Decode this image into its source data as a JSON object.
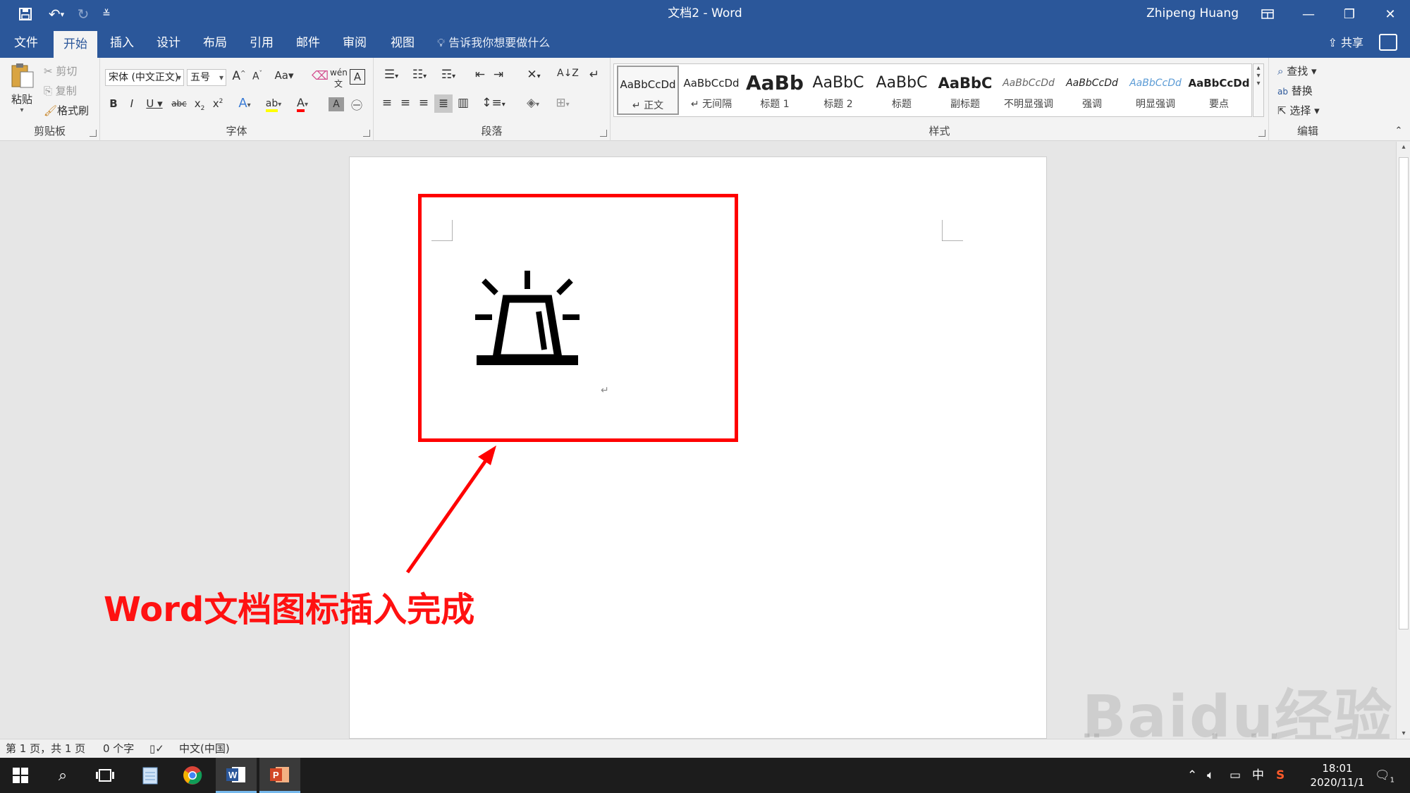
{
  "window": {
    "title": "文档2  -  Word",
    "user": "Zhipeng Huang"
  },
  "tabs": [
    "文件",
    "开始",
    "插入",
    "设计",
    "布局",
    "引用",
    "邮件",
    "审阅",
    "视图"
  ],
  "tell_me": "告诉我你想要做什么",
  "share": "共享",
  "clipboard": {
    "paste": "粘贴",
    "cut": "剪切",
    "copy": "复制",
    "format_painter": "格式刷",
    "label": "剪贴板"
  },
  "font": {
    "font_name": "宋体 (中文正文)",
    "font_size": "五号",
    "label": "字体"
  },
  "paragraph": {
    "label": "段落"
  },
  "styles": {
    "label": "样式",
    "items": [
      {
        "sample": "AaBbCcDd",
        "name": "↵ 正文"
      },
      {
        "sample": "AaBbCcDd",
        "name": "↵ 无间隔"
      },
      {
        "sample": "AaBb",
        "name": "标题 1"
      },
      {
        "sample": "AaBbC",
        "name": "标题 2"
      },
      {
        "sample": "AaBbC",
        "name": "标题"
      },
      {
        "sample": "AaBbC",
        "name": "副标题"
      },
      {
        "sample": "AaBbCcDd",
        "name": "不明显强调"
      },
      {
        "sample": "AaBbCcDd",
        "name": "强调"
      },
      {
        "sample": "AaBbCcDd",
        "name": "明显强调"
      },
      {
        "sample": "AaBbCcDd",
        "name": "要点"
      }
    ]
  },
  "editing": {
    "find": "查找",
    "replace": "替换",
    "select": "选择",
    "label": "编辑"
  },
  "annotation": {
    "caption": "Word文档图标插入完成"
  },
  "status": {
    "page": "第 1 页，共 1 页",
    "words": "0 个字",
    "language": "中文(中国)"
  },
  "taskbar": {
    "time": "18:01",
    "date": "2020/11/1",
    "ime": "中",
    "notification_count": "1"
  },
  "watermark": {
    "line1": "Baidu经验",
    "line2": "jingyan.baidu.com"
  },
  "colors": {
    "word_blue": "#2b579a",
    "annotation_red": "#ff0000",
    "ribbon_bg": "#f3f3f3"
  }
}
